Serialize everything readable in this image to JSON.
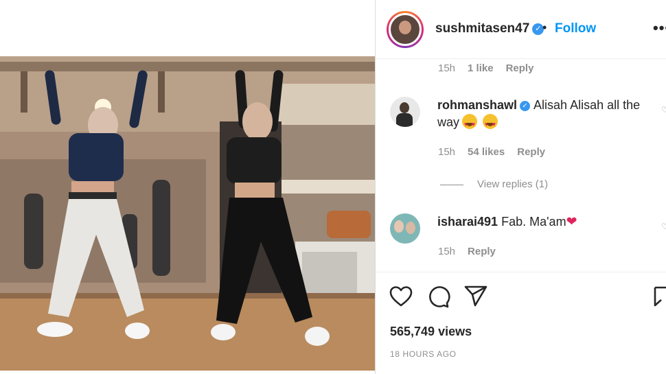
{
  "post": {
    "username": "sushmitasen47",
    "follow_label": "Follow",
    "separator": "•",
    "more_label": "•••"
  },
  "comments": [
    {
      "time": "15h",
      "likes": "1 like",
      "reply_label": "Reply"
    },
    {
      "username": "rohmanshawl",
      "text_before": "Alisah Alisah all the",
      "text_after": "way",
      "time": "15h",
      "likes": "54 likes",
      "reply_label": "Reply",
      "view_replies": "View replies (1)"
    },
    {
      "username": "isharai491",
      "text": "Fab. Ma'am",
      "time": "15h",
      "reply_label": "Reply"
    }
  ],
  "stats": {
    "views": "565,749 views",
    "time_ago": "18 HOURS AGO"
  },
  "icons": {
    "like": "heart-outline-icon",
    "comment": "comment-bubble-icon",
    "share": "paper-plane-icon",
    "save": "bookmark-icon",
    "verified": "verified-badge-icon"
  },
  "colors": {
    "link": "#0095f6",
    "verified": "#3897f0",
    "muted": "#8e8e8e",
    "text": "#262626"
  }
}
